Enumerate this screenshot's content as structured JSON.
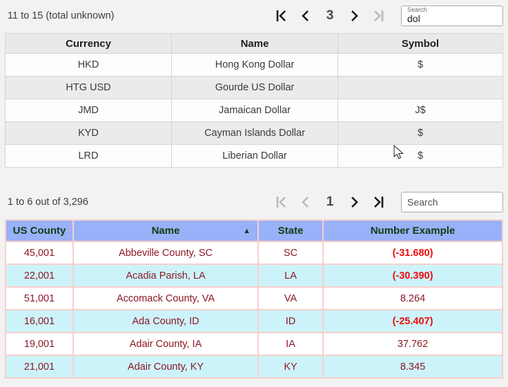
{
  "currency": {
    "status": "11 to 15 (total unknown)",
    "pager": {
      "page": "3"
    },
    "search": {
      "label": "Search",
      "value": "dol"
    },
    "columns": [
      "Currency",
      "Name",
      "Symbol"
    ],
    "rows": [
      [
        "HKD",
        "Hong Kong Dollar",
        "$"
      ],
      [
        "HTG USD",
        "Gourde US Dollar",
        ""
      ],
      [
        "JMD",
        "Jamaican Dollar",
        "J$"
      ],
      [
        "KYD",
        "Cayman Islands Dollar",
        "$"
      ],
      [
        "LRD",
        "Liberian Dollar",
        "$"
      ]
    ]
  },
  "county": {
    "status": "1 to 6 out of 3,296",
    "pager": {
      "page": "1"
    },
    "search": {
      "placeholder": "Search"
    },
    "columns": [
      "US County",
      "Name",
      "State",
      "Number Example"
    ],
    "sort": {
      "column": "Name",
      "direction": "ascending",
      "icon": "▲"
    },
    "rows": [
      [
        "45,001",
        "Abbeville County, SC",
        "SC",
        "(-31.680)"
      ],
      [
        "22,001",
        "Acadia Parish, LA",
        "LA",
        "(-30.390)"
      ],
      [
        "51,001",
        "Accomack County, VA",
        "VA",
        "8.264"
      ],
      [
        "16,001",
        "Ada County, ID",
        "ID",
        "(-25.407)"
      ],
      [
        "19,001",
        "Adair County, IA",
        "IA",
        "37.762"
      ],
      [
        "21,001",
        "Adair County, KY",
        "KY",
        "8.345"
      ]
    ]
  },
  "colors": {
    "page_background": "#f2f2f2",
    "currency_header_bg": "#e9e9e9",
    "currency_alt_row_bg": "#ebebeb",
    "county_header_bg": "#99b1f8",
    "county_header_text": "#0c4014",
    "county_alt_row_bg": "#cdf3fa",
    "county_text": "#8c1826",
    "county_negative_text": "#ee0c0c",
    "county_border": "#f8cfca",
    "pager_enabled": "#1a1a1a",
    "pager_disabled": "#b9b9b9"
  }
}
